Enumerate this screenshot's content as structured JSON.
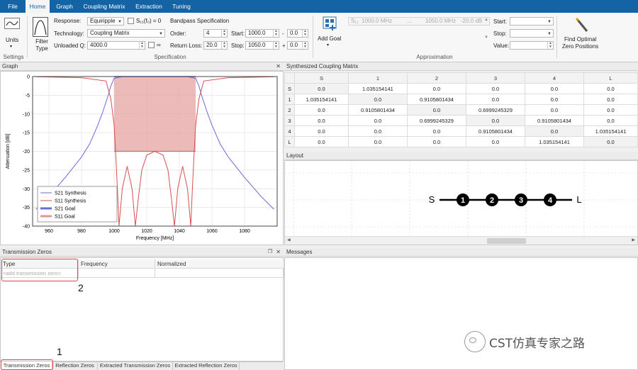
{
  "menu": {
    "tabs": [
      "File",
      "Home",
      "Graph",
      "Coupling Matrix",
      "Extraction",
      "Tuning"
    ]
  },
  "ribbon": {
    "units_label": "Units",
    "settings_label": "Settings",
    "filter_type_label": "Filter Type",
    "response_label": "Response:",
    "response_value": "Equiripple",
    "s11_label": "S₁₁(f₀) = 0",
    "technology_label": "Technology:",
    "technology_value": "Coupling Matrix",
    "unloaded_q_label": "Unloaded Q:",
    "unloaded_q_value": "4000.0",
    "infinity_label": "∞",
    "bandpass_title": "Bandpass Specification",
    "order_label": "Order:",
    "order_value": "4",
    "return_loss_label": "Return Loss:",
    "return_loss_value": "20.0",
    "start_label": "Start:",
    "start_value": "1000.0",
    "stop_label": "Stop:",
    "stop_value": "1050.0",
    "minus_label": "-",
    "plus_label": "+",
    "offset1_value": "0.0",
    "offset2_value": "0.0",
    "specification_label": "Specification",
    "add_goal_label": "Add Goal",
    "goal_s_label": "S₁₁",
    "goal_f1": "1000.0 MHz",
    "goal_dots": "...",
    "goal_f2": "1050.0 MHz",
    "goal_db": "-20.0 dB",
    "appr_start_label": "Start:",
    "appr_stop_label": "Stop:",
    "appr_value_label": "Value:",
    "approximation_label": "Approximation",
    "find_optimal_label": "Find Optimal",
    "zero_positions_label": "Zero Positions"
  },
  "graph": {
    "title": "Graph",
    "close": "✕"
  },
  "chart_data": {
    "type": "line",
    "xlabel": "Frequency [MHz]",
    "ylabel": "Attenuation [dB]",
    "xlim": [
      950,
      1100
    ],
    "ylim": [
      -40,
      0
    ],
    "xticks": [
      960,
      980,
      1000,
      1020,
      1040,
      1060,
      1080
    ],
    "yticks": [
      0,
      -5,
      -10,
      -15,
      -20,
      -25,
      -30,
      -35,
      -40
    ],
    "grid": true,
    "legend_position": "bottom-left",
    "legend": [
      "S21 Synthesis",
      "S11 Synthesis",
      "S21 Goal",
      "S11 Goal"
    ],
    "series": [
      {
        "name": "S21 Synthesis",
        "color": "#6b6bd9",
        "x": [
          952,
          960,
          970,
          980,
          985,
          990,
          993,
          996,
          998,
          1000,
          1005,
          1025,
          1045,
          1050,
          1052,
          1054,
          1057,
          1060,
          1065,
          1070,
          1080,
          1090,
          1098
        ],
        "y": [
          -35.5,
          -32,
          -27,
          -21.5,
          -18,
          -13,
          -9.5,
          -5.5,
          -2.5,
          -0.5,
          0,
          0,
          0,
          -0.5,
          -2.5,
          -5.5,
          -9.5,
          -13,
          -18,
          -21.5,
          -27,
          -32,
          -35.5
        ]
      },
      {
        "name": "S11 Synthesis",
        "color": "#d84f4f",
        "x": [
          952,
          980,
          995,
          998,
          1000,
          1001,
          1002,
          1003,
          1005,
          1008,
          1011,
          1013,
          1015,
          1017,
          1020,
          1025,
          1030,
          1033,
          1035,
          1037,
          1039,
          1042,
          1045,
          1047,
          1048,
          1049,
          1050,
          1052,
          1055,
          1070,
          1098
        ],
        "y": [
          -0.05,
          -0.3,
          -1.2,
          -6,
          -13,
          -21,
          -30,
          -40,
          -30,
          -24,
          -30,
          -40,
          -32,
          -25,
          -21,
          -20,
          -21,
          -25,
          -32,
          -40,
          -30,
          -24,
          -30,
          -40,
          -30,
          -21,
          -13,
          -6,
          -1.2,
          -0.3,
          -0.05
        ]
      }
    ],
    "goals": [
      {
        "name": "S21 Goal",
        "x": [
          1000,
          1050
        ],
        "y": 0
      },
      {
        "name": "S11 Goal",
        "x": [
          1000,
          1050
        ],
        "y": -20
      }
    ]
  },
  "matrix": {
    "title": "Synthesized Coupling Matrix",
    "headers": [
      "S",
      "1",
      "2",
      "3",
      "4",
      "L"
    ],
    "rows": [
      {
        "label": "S",
        "cells": [
          "0.0",
          "1.035154141",
          "0.0",
          "0.0",
          "0.0",
          "0.0"
        ]
      },
      {
        "label": "1",
        "cells": [
          "1.035154141",
          "0.0",
          "0.9105801434",
          "0.0",
          "0.0",
          "0.0"
        ]
      },
      {
        "label": "2",
        "cells": [
          "0.0",
          "0.9105801434",
          "0.0",
          "0.6999245329",
          "0.0",
          "0.0"
        ]
      },
      {
        "label": "3",
        "cells": [
          "0.0",
          "0.0",
          "0.6999245329",
          "0.0",
          "0.9105801434",
          "0.0"
        ]
      },
      {
        "label": "4",
        "cells": [
          "0.0",
          "0.0",
          "0.0",
          "0.9105801434",
          "0.0",
          "1.035154141"
        ]
      },
      {
        "label": "L",
        "cells": [
          "0.0",
          "0.0",
          "0.0",
          "0.0",
          "1.035154141",
          "0.0"
        ]
      }
    ]
  },
  "layout": {
    "title": "Layout",
    "source": "S",
    "load": "L",
    "resonators": [
      "1",
      "2",
      "3",
      "4"
    ]
  },
  "tz": {
    "title": "Transmission Zeros",
    "col_type": "Type",
    "col_frequency": "Frequency",
    "col_normalized": "Normalized",
    "add_placeholder": "<add transmission zero>"
  },
  "messages": {
    "title": "Messages"
  },
  "bottom_tabs": [
    "Transmission Zeros",
    "Reflection Zeros",
    "Extracted Transmission Zeros",
    "Extracted Reflection Zeros"
  ],
  "callouts": {
    "one": "1",
    "two": "2"
  },
  "watermark": "CST仿真专家之路",
  "colors": {
    "accent": "#1464a5",
    "highlight": "#e2474b"
  }
}
